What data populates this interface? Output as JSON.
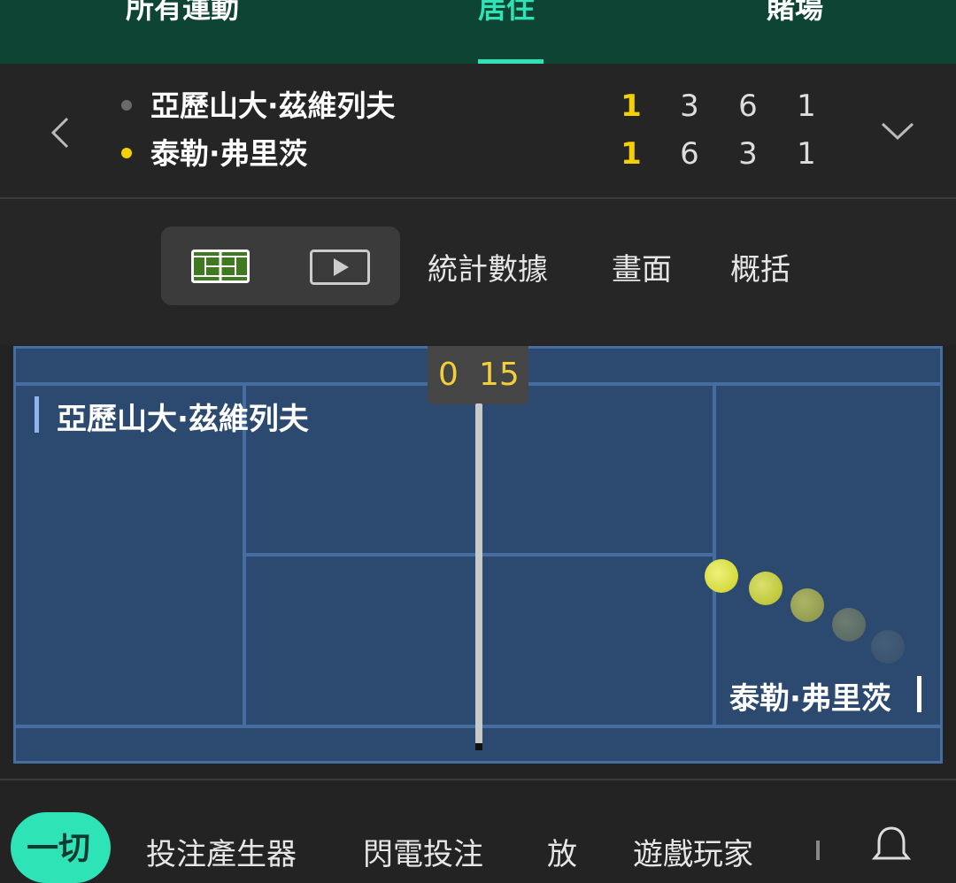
{
  "top_tabs": [
    {
      "label": "所有運動"
    },
    {
      "label": "居住",
      "active": true
    },
    {
      "label": "賭場"
    }
  ],
  "scoreboard": {
    "players": [
      {
        "name": "亞歷山大·茲維列夫",
        "serving": false,
        "scores": [
          "1",
          "3",
          "6",
          "1"
        ]
      },
      {
        "name": "泰勒·弗里茨",
        "serving": true,
        "scores": [
          "1",
          "6",
          "3",
          "1"
        ]
      }
    ],
    "icons": {
      "prev": "chevron-left-icon",
      "expand": "chevron-down-icon"
    }
  },
  "view": {
    "toggle_icons": [
      "court-icon",
      "video-play-icon"
    ],
    "tabs": [
      {
        "label": "統計數據"
      },
      {
        "label": "畫面"
      },
      {
        "label": "概括"
      }
    ]
  },
  "court": {
    "point_score": {
      "left": "0",
      "right": "15"
    },
    "top_player": "亞歷山大·茲維列夫",
    "bottom_player": "泰勒·弗里茨"
  },
  "bottom_nav": {
    "active": "一切",
    "items": [
      {
        "label": "投注產生器"
      },
      {
        "label": "閃電投注"
      },
      {
        "label": "放"
      },
      {
        "label": "遊戲玩家"
      }
    ],
    "icons": {
      "notifications": "bell-icon"
    }
  },
  "colors": {
    "accent": "#2ee3b6",
    "header_bg": "#0e4434",
    "serve_dot": "#f5d000",
    "court_bg": "#2c4a70",
    "court_line": "#466d9f",
    "ball": "#d7dd3a"
  }
}
